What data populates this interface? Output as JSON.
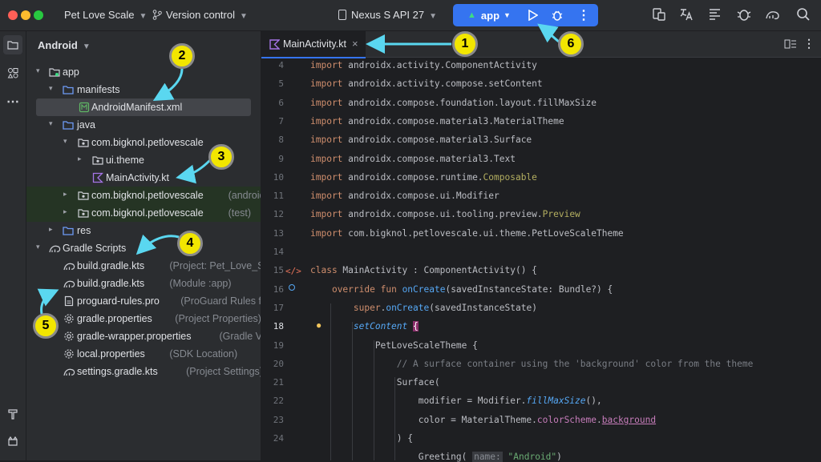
{
  "titlebar": {
    "project_name": "Pet Love Scale",
    "vcs_label": "Version control",
    "device": "Nexus S API 27",
    "run_config": "app"
  },
  "project_panel": {
    "view_mode": "Android",
    "tree": [
      {
        "label": "app",
        "hint": "",
        "icon": "module-folder-icon"
      },
      {
        "label": "manifests",
        "hint": "",
        "icon": "folder-icon"
      },
      {
        "label": "AndroidManifest.xml",
        "hint": "",
        "icon": "manifest-file-icon"
      },
      {
        "label": "java",
        "hint": "",
        "icon": "folder-icon"
      },
      {
        "label": "com.bigknol.petlovescale",
        "hint": "",
        "icon": "package-icon"
      },
      {
        "label": "ui.theme",
        "hint": "",
        "icon": "package-icon"
      },
      {
        "label": "MainActivity.kt",
        "hint": "",
        "icon": "kotlin-file-icon"
      },
      {
        "label": "com.bigknol.petlovescale",
        "hint": "(androidTest)",
        "icon": "package-icon"
      },
      {
        "label": "com.bigknol.petlovescale",
        "hint": "(test)",
        "icon": "package-icon"
      },
      {
        "label": "res",
        "hint": "",
        "icon": "folder-icon"
      },
      {
        "label": "Gradle Scripts",
        "hint": "",
        "icon": "gradle-icon"
      },
      {
        "label": "build.gradle.kts",
        "hint": "(Project: Pet_Love_Scale)",
        "icon": "gradle-file-icon"
      },
      {
        "label": "build.gradle.kts",
        "hint": "(Module :app)",
        "icon": "gradle-file-icon"
      },
      {
        "label": "proguard-rules.pro",
        "hint": "(ProGuard Rules for \":ap",
        "icon": "file-icon"
      },
      {
        "label": "gradle.properties",
        "hint": "(Project Properties)",
        "icon": "settings-file-icon"
      },
      {
        "label": "gradle-wrapper.properties",
        "hint": "(Gradle Version)",
        "icon": "settings-file-icon"
      },
      {
        "label": "local.properties",
        "hint": "(SDK Location)",
        "icon": "settings-file-icon"
      },
      {
        "label": "settings.gradle.kts",
        "hint": "(Project Settings)",
        "icon": "gradle-file-icon"
      }
    ]
  },
  "editor": {
    "tab_label": "MainActivity.kt",
    "line_numbers": [
      "4",
      "5",
      "6",
      "7",
      "8",
      "9",
      "10",
      "11",
      "12",
      "13",
      "14",
      "15",
      "16",
      "17",
      "18",
      "19",
      "20",
      "21",
      "22",
      "23",
      "24"
    ],
    "lines": [
      "import androidx.activity.ComponentActivity",
      "import androidx.activity.compose.setContent",
      "import androidx.compose.foundation.layout.fillMaxSize",
      "import androidx.compose.material3.MaterialTheme",
      "import androidx.compose.material3.Surface",
      "import androidx.compose.material3.Text",
      "import androidx.compose.runtime.Composable",
      "import androidx.compose.ui.Modifier",
      "import androidx.compose.ui.tooling.preview.Preview",
      "import com.bigknol.petlovescale.ui.theme.PetLoveScaleTheme",
      "",
      "class MainActivity : ComponentActivity() {",
      "    override fun onCreate(savedInstanceState: Bundle?) {",
      "        super.onCreate(savedInstanceState)",
      "        setContent {",
      "            PetLoveScaleTheme {",
      "                // A surface container using the 'background' color from the theme",
      "                Surface(",
      "                    modifier = Modifier.fillMaxSize(),",
      "                    color = MaterialTheme.colorScheme.background",
      "                ) {",
      "                    Greeting( name: \"Android\")"
    ]
  },
  "callouts": [
    "1",
    "2",
    "3",
    "4",
    "5",
    "6"
  ],
  "colors": {
    "accent": "#3574f0",
    "callout_fill": "#f2e600",
    "arrow": "#5ad7f0"
  }
}
